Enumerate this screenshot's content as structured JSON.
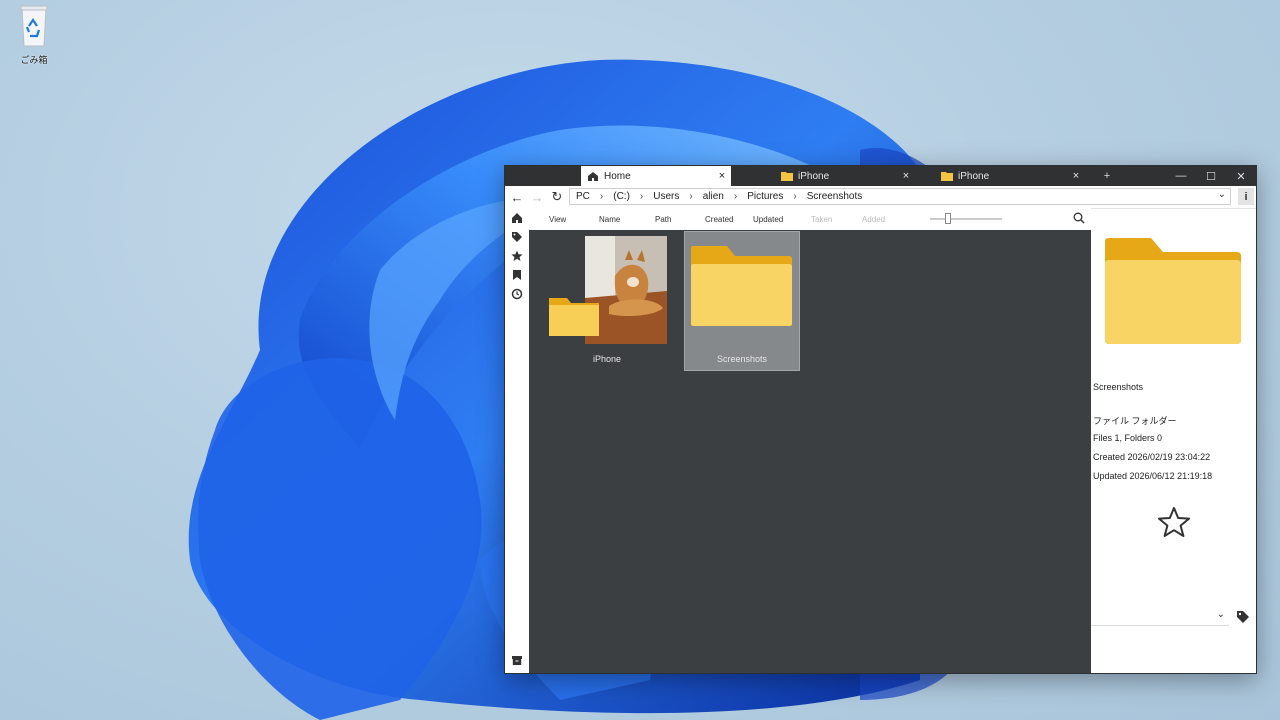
{
  "desktop": {
    "recycle_bin_label": "ごみ箱"
  },
  "window": {
    "tabs": [
      {
        "label": "Home",
        "icon": "home-icon",
        "close": "×"
      },
      {
        "label": "iPhone",
        "icon": "folder-icon",
        "close": "×"
      },
      {
        "label": "iPhone",
        "icon": "folder-icon",
        "close": "×"
      }
    ],
    "new_tab": "+",
    "controls": {
      "minimize": "—",
      "maximize": "☐",
      "close": "✕"
    }
  },
  "navbar": {
    "back": "←",
    "forward": "→",
    "refresh": "↻",
    "breadcrumbs": [
      "PC",
      "(C:)",
      "Users",
      "alien",
      "Pictures",
      "Screenshots"
    ],
    "info": "i"
  },
  "toolbar": {
    "items": [
      "View",
      "Name",
      "Path",
      "Created",
      "Updated",
      "Taken",
      "Added"
    ],
    "slider_value": 0.25
  },
  "content": {
    "items": [
      {
        "name": "iPhone",
        "selected": false
      },
      {
        "name": "Screenshots",
        "selected": true
      }
    ]
  },
  "detail": {
    "name": "Screenshots",
    "type": "ファイル フォルダー",
    "counts": "Files 1, Folders 0",
    "created": "Created   2026/02/19 23:04:22",
    "updated": "Updated  2026/06/12 21:19:18",
    "favorite_icon": "star-outline-icon",
    "tag_icon": "tag-icon"
  },
  "colors": {
    "accent_folder": "#f5c242",
    "content_bg": "#3c3f42",
    "titlebar_bg": "#2f3133"
  }
}
